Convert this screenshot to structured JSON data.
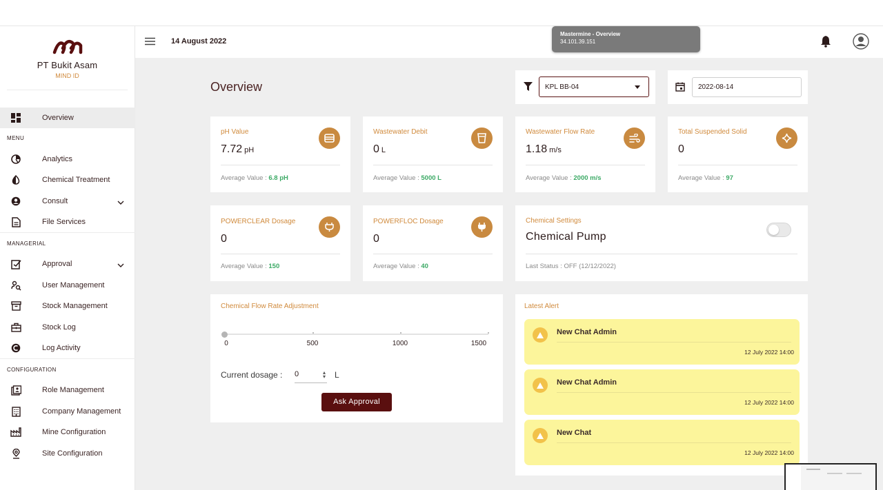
{
  "brand": {
    "company": "PT Bukit Asam",
    "sub": "MIND ID",
    "accent": "#5a0f0f"
  },
  "header": {
    "date": "14 August 2022"
  },
  "tooltip": {
    "title": "Mastermine - Overview",
    "ip": "34.101.39.151"
  },
  "sidebar": {
    "overview": "Overview",
    "sections": {
      "menu": "MENU",
      "managerial": "MANAGERIAL",
      "configuration": "CONFIGURATION"
    },
    "menu": [
      "Analytics",
      "Chemical Treatment",
      "Consult",
      "File Services"
    ],
    "managerial": [
      "Approval",
      "User Management",
      "Stock Management",
      "Stock Log",
      "Log Activity"
    ],
    "configuration": [
      "Role Management",
      "Company Management",
      "Mine Configuration",
      "Site Configuration"
    ]
  },
  "main": {
    "title": "Overview",
    "filter": {
      "selected": "KPL BB-04"
    },
    "date": {
      "value": "2022-08-14"
    },
    "metrics": [
      {
        "label": "pH Value",
        "value": "7.72",
        "unit": "pH",
        "avg_label": "Average Value : ",
        "avg": "6.8 pH",
        "icon": "card-icon"
      },
      {
        "label": "Wastewater Debit",
        "value": "0",
        "unit": "L",
        "avg_label": "Average Value : ",
        "avg": "5000 L",
        "icon": "cup-icon"
      },
      {
        "label": "Wastewater Flow Rate",
        "value": "1.18",
        "unit": "m/s",
        "avg_label": "Average Value : ",
        "avg": "2000 m/s",
        "icon": "wind-icon"
      },
      {
        "label": "Total Suspended Solid",
        "value": "0",
        "unit": "",
        "avg_label": "Average Value : ",
        "avg": "97",
        "icon": "sparkle-icon"
      },
      {
        "label": "POWERCLEAR Dosage",
        "value": "0",
        "unit": "",
        "avg_label": "Average Value : ",
        "avg": "150",
        "icon": "plug-icon"
      },
      {
        "label": "POWERFLOC Dosage",
        "value": "0",
        "unit": "",
        "avg_label": "Average Value : ",
        "avg": "40",
        "icon": "plug-icon"
      }
    ],
    "chemical": {
      "label": "Chemical Settings",
      "title": "Chemical Pump",
      "status": "Last Status : OFF (12/12/2022)",
      "enabled": false
    },
    "flow_adjust": {
      "title": "Chemical Flow Rate Adjustment",
      "ticks": [
        "0",
        "500",
        "1000",
        "1500"
      ],
      "slider_value": 0,
      "dosage_label": "Current dosage :",
      "dosage_value": "0",
      "dosage_unit": "L",
      "button": "Ask Approval"
    },
    "alerts": {
      "title": "Latest Alert",
      "items": [
        {
          "title": "New Chat Admin",
          "time": "12 July 2022 14:00"
        },
        {
          "title": "New Chat Admin",
          "time": "12 July 2022 14:00"
        },
        {
          "title": "New Chat",
          "time": "12 July 2022 14:00"
        }
      ]
    }
  },
  "colors": {
    "accent": "#5a0f0f",
    "orange": "#c98a40",
    "label_orange": "#d08a3c",
    "green": "#3daa66",
    "alert_bg": "#fcf59b"
  }
}
